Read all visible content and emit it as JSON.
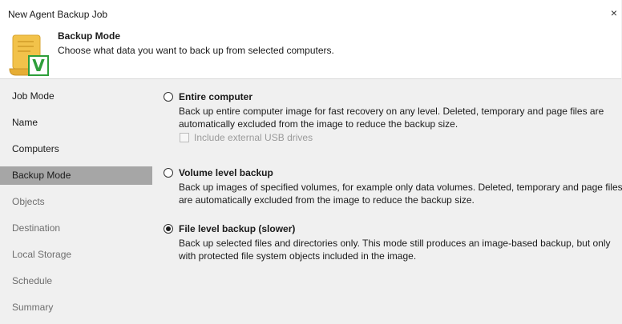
{
  "window": {
    "title": "New Agent Backup Job",
    "close_glyph": "×"
  },
  "header": {
    "title": "Backup Mode",
    "subtitle": "Choose what data you want to back up from selected computers.",
    "logo_letter": "V"
  },
  "sidebar": {
    "items": [
      {
        "label": "Job Mode",
        "state": "done"
      },
      {
        "label": "Name",
        "state": "done"
      },
      {
        "label": "Computers",
        "state": "done"
      },
      {
        "label": "Backup Mode",
        "state": "active"
      },
      {
        "label": "Objects",
        "state": "pending"
      },
      {
        "label": "Destination",
        "state": "pending"
      },
      {
        "label": "Local Storage",
        "state": "pending"
      },
      {
        "label": "Schedule",
        "state": "pending"
      },
      {
        "label": "Summary",
        "state": "pending"
      }
    ]
  },
  "options": {
    "entire": {
      "label": "Entire computer",
      "description": "Back up entire computer image for fast recovery on any level. Deleted, temporary and page files are automatically excluded from the image to reduce the backup size.",
      "selected": false,
      "usb_label": "Include external USB drives",
      "usb_checked": false,
      "usb_enabled": false
    },
    "volume": {
      "label": "Volume level backup",
      "description": "Back up images of specified volumes, for example only data volumes. Deleted, temporary and page files are automatically excluded from the image to reduce the backup size.",
      "selected": false
    },
    "file": {
      "label": "File level backup (slower)",
      "description": "Back up selected files and directories only. This mode still produces an image-based backup, but only with protected file system objects included in the image.",
      "selected": true
    }
  },
  "colors": {
    "sidebar_active": "#a6a6a6",
    "logo_scroll": "#f2c24a",
    "logo_badge": "#2e9e3a"
  }
}
